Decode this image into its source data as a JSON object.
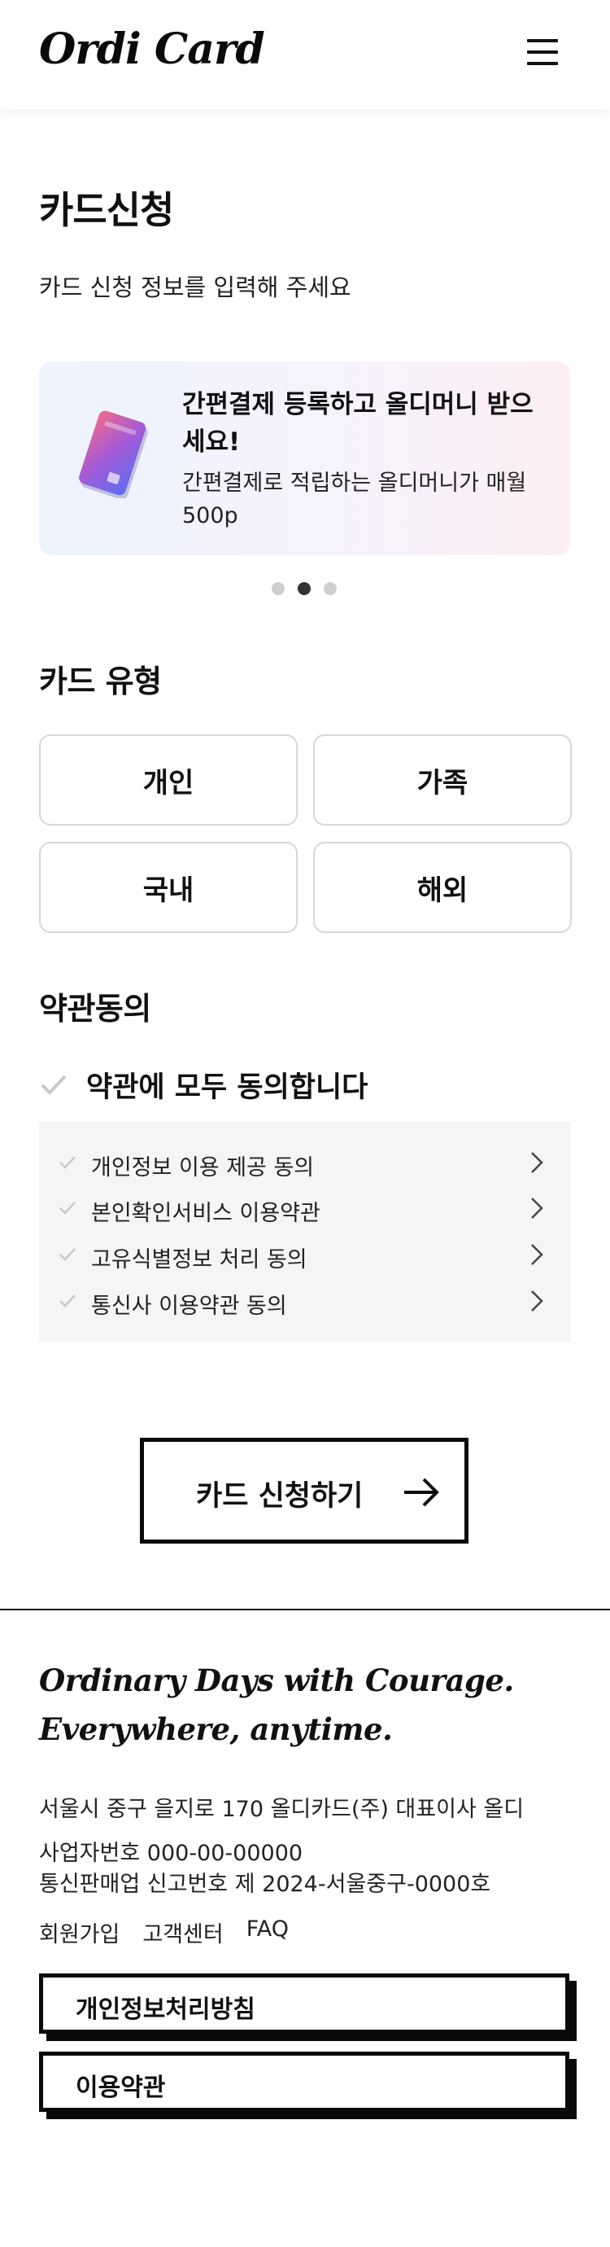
{
  "header": {
    "logo": "Ordi Card",
    "menu_icon": "hamburger-menu-icon"
  },
  "page": {
    "title": "카드신청",
    "subtitle": "카드 신청 정보를 입력해 주세요"
  },
  "banner": {
    "title": "간편결제 등록하고 올디머니 받으세요!",
    "description": "간편결제로 적립하는 올디머니가 매월 500p",
    "image_icon": "credit-card-icon",
    "slides_total": 3,
    "active_slide": 2
  },
  "card_type": {
    "heading": "카드 유형",
    "options": [
      "개인",
      "가족",
      "국내",
      "해외"
    ]
  },
  "terms": {
    "heading": "약관동의",
    "agree_all": "약관에 모두 동의합니다",
    "items": [
      "개인정보 이용 제공 동의",
      "본인확인서비스 이용약관",
      "고유식별정보 처리 동의",
      "통신사 이용약관 동의"
    ]
  },
  "apply": {
    "label": "카드 신청하기",
    "icon": "arrow-right-icon"
  },
  "footer": {
    "slogan_line1": "Ordinary Days with Courage.",
    "slogan_line2": "Everywhere, anytime.",
    "address": "서울시 중구 을지로 170 올디카드(주) 대표이사 올디",
    "business_no": "사업자번호 000-00-00000",
    "mail_order_no": "통신판매업 신고번호 제 2024-서울중구-0000호",
    "links": [
      "회원가입",
      "고객센터",
      "FAQ"
    ],
    "privacy_button": "개인정보처리방침",
    "terms_button": "이용약관"
  },
  "colors": {
    "text": "#111111",
    "banner_gradient_start": "#edf3ff",
    "banner_gradient_end": "#fdeef4",
    "border": "#d7d7d7",
    "check": "#c8c8c8",
    "terms_bg": "#f4f5f6"
  }
}
